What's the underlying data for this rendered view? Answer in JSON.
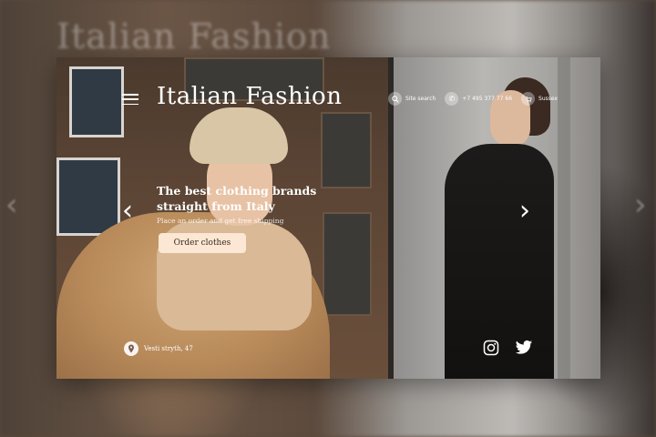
{
  "background": {
    "title_ghost": "Italian Fashion",
    "left_arrow": "‹",
    "right_arrow": "›"
  },
  "header": {
    "title": "Italian Fashion",
    "menu_icon": "hamburger-icon",
    "search": {
      "icon": "search-icon",
      "label": "Site search"
    },
    "phone": {
      "icon": "phone-icon",
      "label": "+7 495 377 77 66"
    },
    "cart": {
      "icon": "cart-icon",
      "label": "Sussex"
    }
  },
  "hero": {
    "headline": "The best clothing brands straight from Italy",
    "subline": "Place an order and get free shipping",
    "cta_label": "Order clothes",
    "prev_arrow": "‹",
    "next_arrow": "›"
  },
  "footer": {
    "address_icon": "location-pin-icon",
    "address": "Vesti stryth, 47",
    "social": [
      {
        "icon": "instagram-icon"
      },
      {
        "icon": "twitter-icon"
      }
    ]
  },
  "colors": {
    "cta_bg": "#fbe7d3",
    "text": "#ffffff"
  }
}
